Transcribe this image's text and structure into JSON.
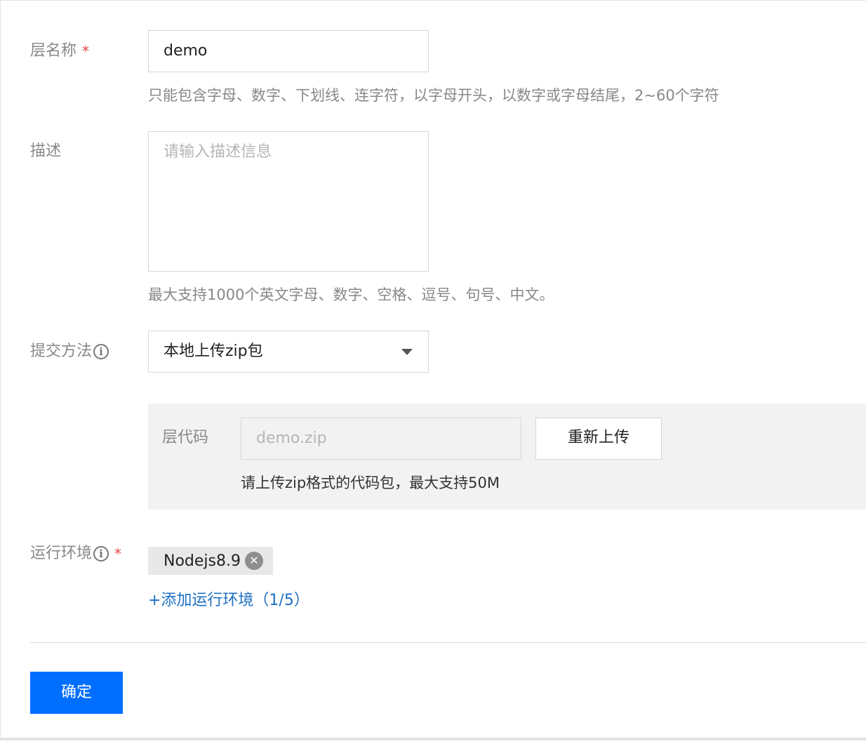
{
  "form": {
    "layer_name": {
      "label": "层名称",
      "required_mark": "*",
      "value": "demo",
      "hint": "只能包含字母、数字、下划线、连字符，以字母开头，以数字或字母结尾，2~60个字符"
    },
    "description": {
      "label": "描述",
      "placeholder": "请输入描述信息",
      "hint": "最大支持1000个英文字母、数字、空格、逗号、句号、中文。"
    },
    "submit_method": {
      "label": "提交方法",
      "info_icon": "info-circle-icon",
      "selected": "本地上传zip包"
    },
    "upload": {
      "label": "层代码",
      "file_placeholder": "demo.zip",
      "reupload_label": "重新上传",
      "hint": "请上传zip格式的代码包，最大支持50M"
    },
    "runtime": {
      "label": "运行环境",
      "info_icon": "info-circle-icon",
      "required_mark": "*",
      "tags": [
        "Nodejs8.9"
      ],
      "add_link": "+添加运行环境（1/5）"
    },
    "confirm_label": "确定"
  },
  "colors": {
    "primary": "#006eff",
    "link": "#1d6fc4",
    "required": "#e54545",
    "label": "#888888"
  }
}
